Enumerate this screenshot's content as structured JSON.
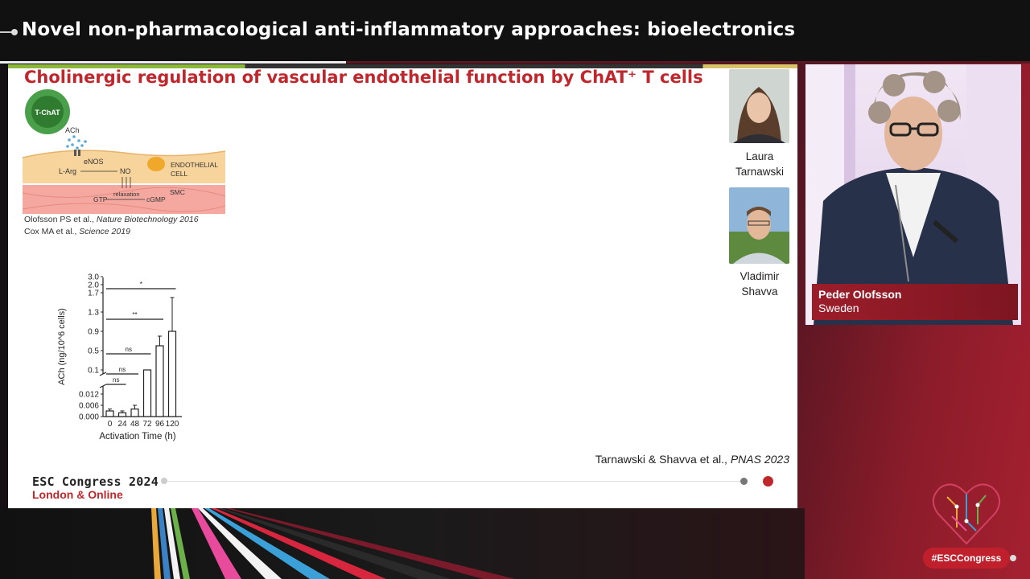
{
  "session": {
    "title": "Novel non-pharmacological anti-inflammatory approaches: bioelectronics"
  },
  "slide": {
    "title": "Cholinergic regulation of vascular endothelial function by ChAT⁺ T cells",
    "diagram": {
      "tcell_label": "T-ChAT",
      "ach_label": "ACh",
      "enos_label": "eNOS",
      "larg_label": "L-Arg",
      "no_label": "NO",
      "endothelial_label_1": "ENDOTHELIAL",
      "endothelial_label_2": "CELL",
      "relaxation_label": "relaxation",
      "smc_label": "SMC",
      "gtp_label": "GTP",
      "cgmp_label": "cGMP"
    },
    "references": [
      {
        "authors": "Olofsson PS et al., ",
        "journal": "Nature Biotechnology 2016"
      },
      {
        "authors": "Cox MA et al., ",
        "journal": "Science 2019"
      }
    ],
    "people": [
      {
        "first": "Laura",
        "last": "Tarnawski"
      },
      {
        "first": "Vladimir",
        "last": "Shavva"
      }
    ],
    "citation": {
      "authors": "Tarnawski & Shavva et al., ",
      "journal": "PNAS 2023"
    },
    "congress": {
      "name": "ESC Congress 2024",
      "location": "London & Online"
    }
  },
  "chart_data": {
    "type": "bar",
    "xlabel": "Activation Time (h)",
    "ylabel": "ACh (ng/10^6 cells)",
    "categories": [
      "0",
      "24",
      "48",
      "72",
      "96",
      "120"
    ],
    "values": [
      0.003,
      0.002,
      0.004,
      0.1,
      0.6,
      0.9
    ],
    "error_upper": [
      0.004,
      0.003,
      0.006,
      0.1,
      0.8,
      1.6
    ],
    "y_ticks_lower": [
      "0.000",
      "0.006",
      "0.012"
    ],
    "y_ticks_upper": [
      "0.1",
      "0.5",
      "0.9",
      "1.3",
      "1.7",
      "2.0",
      "3.0"
    ],
    "axis_break": true,
    "significance": [
      {
        "label": "ns",
        "from": "0",
        "to": "24"
      },
      {
        "label": "ns",
        "from": "0",
        "to": "48"
      },
      {
        "label": "ns",
        "from": "0",
        "to": "72"
      },
      {
        "label": "**",
        "from": "0",
        "to": "96"
      },
      {
        "label": "*",
        "from": "0",
        "to": "120"
      }
    ]
  },
  "speaker": {
    "name": "Peder Olofsson",
    "country": "Sweden"
  },
  "hashtag": "#ESCCongress",
  "colors": {
    "accent_red": "#c0272d",
    "label_red": "#9c1d2a",
    "pill_red": "#c0202c"
  }
}
